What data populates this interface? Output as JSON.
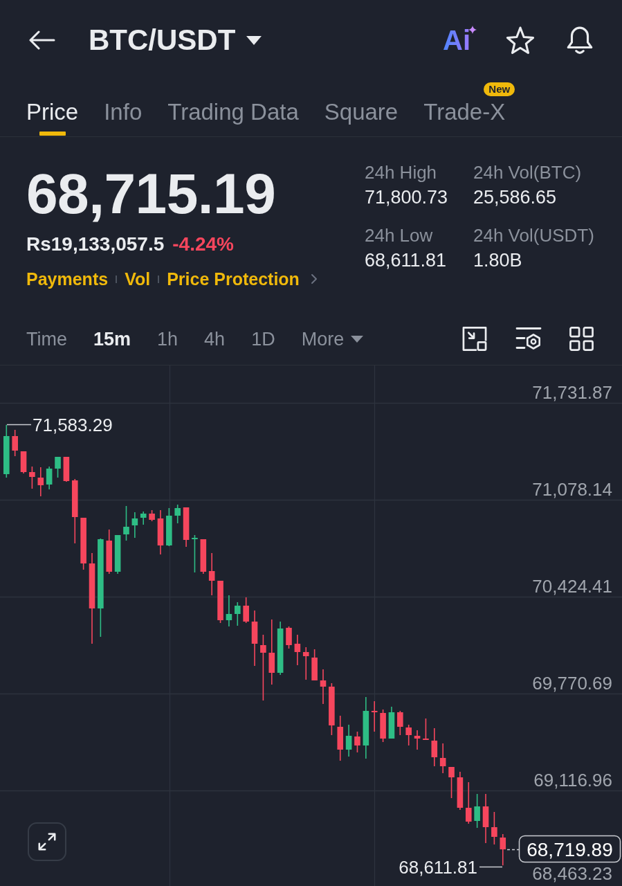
{
  "header": {
    "title": "BTC/USDT",
    "ai_label": "Ai"
  },
  "tabs": [
    {
      "label": "Price",
      "selected": true
    },
    {
      "label": "Info",
      "selected": false
    },
    {
      "label": "Trading Data",
      "selected": false
    },
    {
      "label": "Square",
      "selected": false
    },
    {
      "label": "Trade-X",
      "selected": false,
      "badge": "New"
    }
  ],
  "ticker": {
    "last_price": "68,715.19",
    "local_price": "Rs19,133,057.5",
    "change": "-4.24%",
    "links": [
      "Payments",
      "Vol",
      "Price Protection"
    ]
  },
  "stats": [
    {
      "label": "24h High",
      "value": "71,800.73"
    },
    {
      "label": "24h Vol(BTC)",
      "value": "25,586.65"
    },
    {
      "label": "24h Low",
      "value": "68,611.81"
    },
    {
      "label": "24h Vol(USDT)",
      "value": "1.80B"
    }
  ],
  "intervals": [
    {
      "label": "Time",
      "kind": "option",
      "selected": false
    },
    {
      "label": "15m",
      "kind": "option",
      "selected": true
    },
    {
      "label": "1h",
      "kind": "option",
      "selected": false
    },
    {
      "label": "4h",
      "kind": "option",
      "selected": false
    },
    {
      "label": "1D",
      "kind": "option",
      "selected": false
    },
    {
      "label": "More",
      "kind": "dropdown",
      "selected": false
    }
  ],
  "chart": {
    "high_marker": "71,583.29",
    "low_marker": "68,611.81",
    "last_price": "68,719.89",
    "chart_data": {
      "type": "candlestick",
      "grid": true,
      "ohlc": [
        [
          71250.91,
          71583.29,
          71227.56,
          71507.73
        ],
        [
          71507.73,
          71549.76,
          71372.32,
          71409.67
        ],
        [
          71405.0,
          71405.0,
          71255.58,
          71264.92
        ],
        [
          71264.92,
          71302.28,
          71152.85,
          71232.23
        ],
        [
          71227.56,
          71297.61,
          71101.49,
          71176.2
        ],
        [
          71180.87,
          71302.28,
          71148.18,
          71288.27
        ],
        [
          71288.27,
          71367.65,
          71227.56,
          71367.65
        ],
        [
          71367.65,
          71367.65,
          71199.55,
          71204.22
        ],
        [
          71208.89,
          71218.22,
          70783.96,
          70961.4
        ],
        [
          70956.73,
          70956.73,
          70606.52,
          70648.55
        ],
        [
          70648.55,
          70718.59,
          70106.88,
          70345.03
        ],
        [
          70345.03,
          70816.65,
          70153.58,
          70811.98
        ],
        [
          70802.64,
          70877.35,
          70578.5,
          70592.51
        ],
        [
          70592.51,
          70840.0,
          70578.5,
          70840.0
        ],
        [
          70844.66,
          71036.11,
          70802.64,
          70896.03
        ],
        [
          70905.37,
          70994.09,
          70821.32,
          70952.06
        ],
        [
          70956.73,
          70998.76,
          70910.04,
          70984.75
        ],
        [
          70984.75,
          71008.1,
          70933.39,
          70942.72
        ],
        [
          70952.06,
          71008.1,
          70709.25,
          70769.95
        ],
        [
          70769.95,
          71022.11,
          70765.28,
          70970.74
        ],
        [
          70970.74,
          71045.45,
          70919.38,
          71022.11
        ],
        [
          71026.78,
          71026.78,
          70760.61,
          70807.31
        ],
        [
          70811.98,
          70840.0,
          70587.84,
          70821.32
        ],
        [
          70811.98,
          70811.98,
          70578.5,
          70592.51
        ],
        [
          70597.18,
          70718.59,
          70433.75,
          70531.81
        ],
        [
          70531.81,
          70531.81,
          70246.97,
          70265.65
        ],
        [
          70265.65,
          70433.75,
          70223.62,
          70307.67
        ],
        [
          70307.67,
          70387.05,
          70228.29,
          70363.71
        ],
        [
          70363.71,
          70419.74,
          70246.97,
          70256.31
        ],
        [
          70256.31,
          70331.02,
          69957.46,
          70106.88
        ],
        [
          70097.54,
          70167.59,
          69723.98,
          70046.18
        ],
        [
          70046.18,
          70270.32,
          69831.38,
          69910.76
        ],
        [
          69910.76,
          70256.31,
          69896.76,
          70209.61
        ],
        [
          70214.28,
          70223.62,
          70074.2,
          70097.54
        ],
        [
          70106.88,
          70167.59,
          69962.13,
          70050.85
        ],
        [
          70050.85,
          70083.54,
          69864.07,
          70022.83
        ],
        [
          70013.49,
          70069.53,
          69859.4,
          69859.4
        ],
        [
          69859.4,
          69934.11,
          69700.64,
          69817.37
        ],
        [
          69817.37,
          69840.72,
          69490.51,
          69555.88
        ],
        [
          69546.54,
          69621.26,
          69317.74,
          69392.45
        ],
        [
          69392.45,
          69560.55,
          69345.76,
          69485.84
        ],
        [
          69481.17,
          69513.86,
          69373.77,
          69420.47
        ],
        [
          69420.47,
          69747.33,
          69331.75,
          69653.94
        ],
        [
          69653.94,
          69719.32,
          69513.86,
          69644.6
        ],
        [
          69639.93,
          69663.28,
          69443.81,
          69467.16
        ],
        [
          69467.16,
          69681.96,
          69467.16,
          69644.6
        ],
        [
          69644.6,
          69653.94,
          69490.51,
          69546.54
        ],
        [
          69541.87,
          69560.55,
          69420.47,
          69490.51
        ],
        [
          69485.84,
          69523.2,
          69392.45,
          69467.16
        ],
        [
          69467.16,
          69602.58,
          69457.82,
          69457.82
        ],
        [
          69453.15,
          69537.2,
          69280.38,
          69341.09
        ],
        [
          69336.42,
          69434.48,
          69233.69,
          69280.38
        ],
        [
          69275.71,
          69275.71,
          69065.59,
          69205.67
        ],
        [
          69205.67,
          69243.03,
          68986.2,
          69000.21
        ],
        [
          69000.21,
          69172.98,
          68892.81,
          68906.82
        ],
        [
          68911.49,
          69093.6,
          68864.8,
          69009.55
        ],
        [
          69009.55,
          69093.6,
          68762.07,
          68869.47
        ],
        [
          68869.47,
          68972.2,
          68752.73,
          68804.09
        ],
        [
          68799.42,
          68822.77,
          68611.81,
          68719.89
        ]
      ],
      "ylim": [
        68458.57,
        71984.02
      ],
      "yticks": [
        {
          "value": 71731.87,
          "label": "71,731.87"
        },
        {
          "value": 71078.14,
          "label": "71,078.14"
        },
        {
          "value": 70424.41,
          "label": "70,424.41"
        },
        {
          "value": 69770.69,
          "label": "69,770.69"
        },
        {
          "value": 69116.96,
          "label": "69,116.96"
        },
        {
          "value": 68463.23,
          "label": "68,463.23"
        }
      ]
    }
  }
}
